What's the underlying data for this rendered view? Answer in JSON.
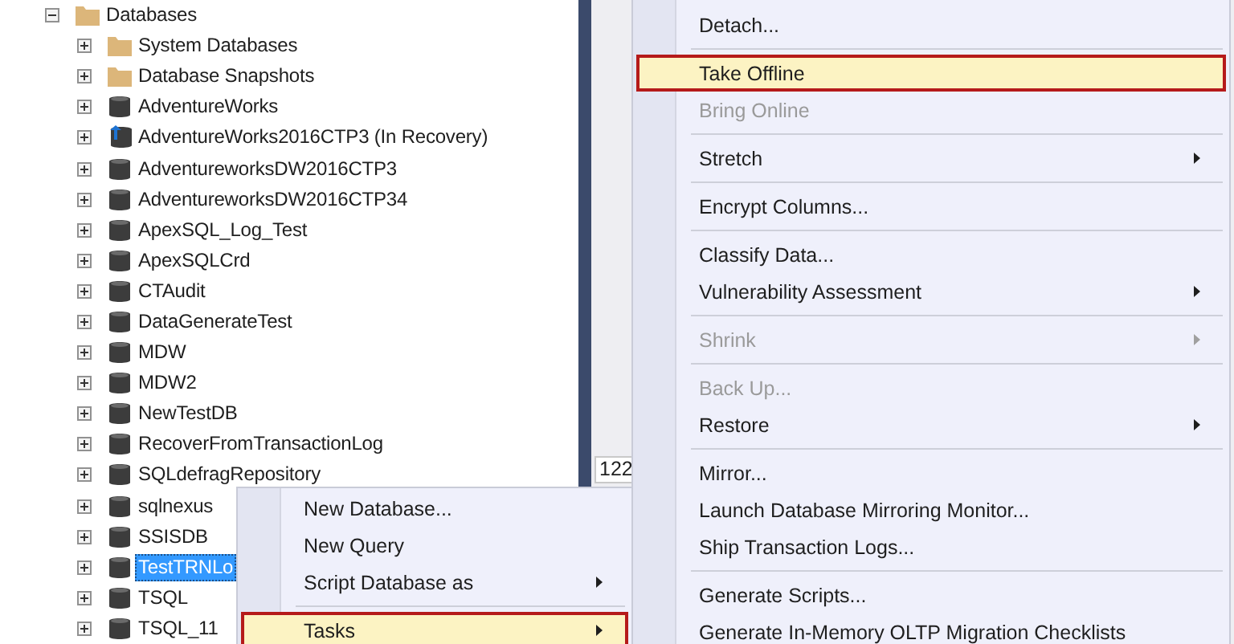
{
  "tree": {
    "label": "Databases",
    "kind": "folder",
    "expanded": true,
    "selected": false,
    "children": [
      {
        "label": "System Databases",
        "kind": "folder",
        "expanded": false,
        "selected": false
      },
      {
        "label": "Database Snapshots",
        "kind": "folder",
        "expanded": false,
        "selected": false
      },
      {
        "label": "AdventureWorks",
        "kind": "database",
        "expanded": false,
        "selected": false
      },
      {
        "label": "AdventureWorks2016CTP3 (In Recovery)",
        "kind": "database-restoring",
        "expanded": false,
        "selected": false
      },
      {
        "label": "AdventureworksDW2016CTP3",
        "kind": "database",
        "expanded": false,
        "selected": false
      },
      {
        "label": "AdventureworksDW2016CTP34",
        "kind": "database",
        "expanded": false,
        "selected": false
      },
      {
        "label": "ApexSQL_Log_Test",
        "kind": "database",
        "expanded": false,
        "selected": false
      },
      {
        "label": "ApexSQLCrd",
        "kind": "database",
        "expanded": false,
        "selected": false
      },
      {
        "label": "CTAudit",
        "kind": "database",
        "expanded": false,
        "selected": false
      },
      {
        "label": "DataGenerateTest",
        "kind": "database",
        "expanded": false,
        "selected": false
      },
      {
        "label": "MDW",
        "kind": "database",
        "expanded": false,
        "selected": false
      },
      {
        "label": "MDW2",
        "kind": "database",
        "expanded": false,
        "selected": false
      },
      {
        "label": "NewTestDB",
        "kind": "database",
        "expanded": false,
        "selected": false
      },
      {
        "label": "RecoverFromTransactionLog",
        "kind": "database",
        "expanded": false,
        "selected": false
      },
      {
        "label": "SQLdefragRepository",
        "kind": "database",
        "expanded": false,
        "selected": false
      },
      {
        "label": "sqlnexus",
        "kind": "database",
        "expanded": false,
        "selected": false
      },
      {
        "label": "SSISDB",
        "kind": "database",
        "expanded": false,
        "selected": false
      },
      {
        "label": "TestTRNLo",
        "kind": "database",
        "expanded": false,
        "selected": true
      },
      {
        "label": "TSQL",
        "kind": "database",
        "expanded": false,
        "selected": false
      },
      {
        "label": "TSQL_11",
        "kind": "database",
        "expanded": false,
        "selected": false
      }
    ]
  },
  "editor": {
    "number": "122"
  },
  "context_menu": {
    "items": [
      {
        "kind": "item",
        "label": "New Database...",
        "disabled": false,
        "selected": false,
        "submenu": false
      },
      {
        "kind": "item",
        "label": "New Query",
        "disabled": false,
        "selected": false,
        "submenu": false
      },
      {
        "kind": "item",
        "label": "Script Database as",
        "disabled": false,
        "selected": false,
        "submenu": true
      },
      {
        "kind": "separator"
      },
      {
        "kind": "item",
        "label": "Tasks",
        "disabled": false,
        "selected": true,
        "submenu": true
      }
    ]
  },
  "tasks_submenu": {
    "items": [
      {
        "kind": "item",
        "label": "Detach...",
        "disabled": false,
        "selected": false,
        "submenu": false
      },
      {
        "kind": "separator"
      },
      {
        "kind": "item",
        "label": "Take Offline",
        "disabled": false,
        "selected": true,
        "submenu": false
      },
      {
        "kind": "item",
        "label": "Bring Online",
        "disabled": true,
        "selected": false,
        "submenu": false
      },
      {
        "kind": "separator"
      },
      {
        "kind": "item",
        "label": "Stretch",
        "disabled": false,
        "selected": false,
        "submenu": true
      },
      {
        "kind": "separator"
      },
      {
        "kind": "item",
        "label": "Encrypt Columns...",
        "disabled": false,
        "selected": false,
        "submenu": false
      },
      {
        "kind": "separator"
      },
      {
        "kind": "item",
        "label": "Classify Data...",
        "disabled": false,
        "selected": false,
        "submenu": false
      },
      {
        "kind": "item",
        "label": "Vulnerability Assessment",
        "disabled": false,
        "selected": false,
        "submenu": true
      },
      {
        "kind": "separator"
      },
      {
        "kind": "item",
        "label": "Shrink",
        "disabled": true,
        "selected": false,
        "submenu": true
      },
      {
        "kind": "separator"
      },
      {
        "kind": "item",
        "label": "Back Up...",
        "disabled": true,
        "selected": false,
        "submenu": false
      },
      {
        "kind": "item",
        "label": "Restore",
        "disabled": false,
        "selected": false,
        "submenu": true
      },
      {
        "kind": "separator"
      },
      {
        "kind": "item",
        "label": "Mirror...",
        "disabled": false,
        "selected": false,
        "submenu": false
      },
      {
        "kind": "item",
        "label": "Launch Database Mirroring Monitor...",
        "disabled": false,
        "selected": false,
        "submenu": false
      },
      {
        "kind": "item",
        "label": "Ship Transaction Logs...",
        "disabled": false,
        "selected": false,
        "submenu": false
      },
      {
        "kind": "separator"
      },
      {
        "kind": "item",
        "label": "Generate Scripts...",
        "disabled": false,
        "selected": false,
        "submenu": false
      },
      {
        "kind": "item",
        "label": "Generate In-Memory OLTP Migration Checklists",
        "disabled": false,
        "selected": false,
        "submenu": false
      }
    ]
  }
}
